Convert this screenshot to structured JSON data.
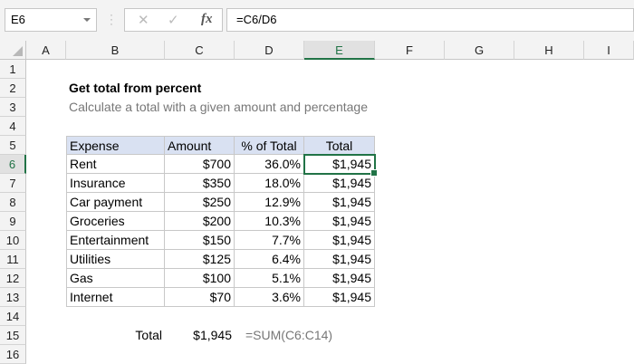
{
  "formula_bar": {
    "name_box": "E6",
    "cancel_icon": "✕",
    "enter_icon": "✓",
    "fx_label": "fx",
    "formula": "=C6/D6"
  },
  "columns": [
    "A",
    "B",
    "C",
    "D",
    "E",
    "F",
    "G",
    "H",
    "I"
  ],
  "rows": [
    "1",
    "2",
    "3",
    "4",
    "5",
    "6",
    "7",
    "8",
    "9",
    "10",
    "11",
    "12",
    "13",
    "14",
    "15",
    "16"
  ],
  "title": "Get total from percent",
  "subtitle": "Calculate a total with a given amount and percentage",
  "table": {
    "headers": [
      "Expense",
      "Amount",
      "% of Total",
      "Total"
    ],
    "rows": [
      [
        "Rent",
        "$700",
        "36.0%",
        "$1,945"
      ],
      [
        "Insurance",
        "$350",
        "18.0%",
        "$1,945"
      ],
      [
        "Car payment",
        "$250",
        "12.9%",
        "$1,945"
      ],
      [
        "Groceries",
        "$200",
        "10.3%",
        "$1,945"
      ],
      [
        "Entertainment",
        "$150",
        "7.7%",
        "$1,945"
      ],
      [
        "Utilities",
        "$125",
        "6.4%",
        "$1,945"
      ],
      [
        "Gas",
        "$100",
        "5.1%",
        "$1,945"
      ],
      [
        "Internet",
        "$70",
        "3.6%",
        "$1,945"
      ]
    ]
  },
  "summary": {
    "label": "Total",
    "value": "$1,945",
    "formula": "=SUM(C6:C14)"
  }
}
